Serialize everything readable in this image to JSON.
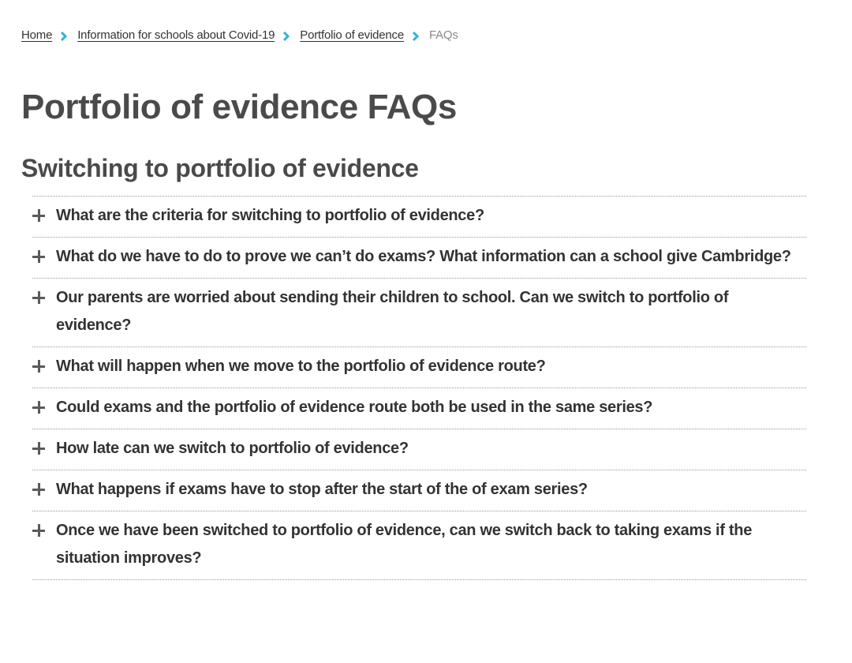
{
  "colors": {
    "accent": "#2fb3d4",
    "text": "#333333",
    "heading": "#4a4a4a",
    "muted": "#888888"
  },
  "breadcrumb": {
    "items": [
      {
        "label": "Home",
        "link": true
      },
      {
        "label": "Information for schools about Covid-19",
        "link": true
      },
      {
        "label": "Portfolio of evidence",
        "link": true
      },
      {
        "label": "FAQs",
        "link": false
      }
    ],
    "separator_icon": "chevron-right-icon"
  },
  "page": {
    "title": "Portfolio of evidence FAQs",
    "section_title": "Switching to portfolio of evidence"
  },
  "faqs": [
    {
      "question": "What are the criteria for switching to portfolio of evidence?",
      "icon": "plus-icon"
    },
    {
      "question": "What do we have to do to prove we can’t do exams? What information can a school give Cambridge?",
      "icon": "plus-icon"
    },
    {
      "question": "Our parents are worried about sending their children to school. Can we switch to portfolio of evidence?",
      "icon": "plus-icon"
    },
    {
      "question": "What will happen when we move to the portfolio of evidence route?",
      "icon": "plus-icon"
    },
    {
      "question": "Could exams and the portfolio of evidence route both be used in the same series?",
      "icon": "plus-icon"
    },
    {
      "question": "How late can we switch to portfolio of evidence?",
      "icon": "plus-icon"
    },
    {
      "question": "What happens if exams have to stop after the start of the of exam series?",
      "icon": "plus-icon"
    },
    {
      "question": "Once we have been switched to portfolio of evidence, can we switch back to taking exams if the situation improves?",
      "icon": "plus-icon"
    }
  ]
}
